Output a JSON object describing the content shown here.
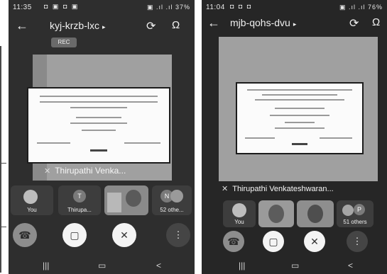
{
  "phone_a": {
    "status_time": "11:35",
    "status_notifications": "◘ ▣ ◘ ▣",
    "status_right": "▣ .ıl .ıl 37%",
    "meeting_code": "kyj-krzb-lxc",
    "rec_label": "REC",
    "presenter_name": "Thirupathi Venka...",
    "tiles": [
      {
        "label": "You"
      },
      {
        "label": "Thirupa..."
      },
      {
        "label": ""
      },
      {
        "label": "52 othe..."
      }
    ],
    "others_initial": "N",
    "thirupathi_initial": "T"
  },
  "phone_b": {
    "status_time": "11:04",
    "status_notifications": "◘ ◘ ◘",
    "status_right": "▣ .ıl .ıl 76%",
    "meeting_code": "mjb-qohs-dvu",
    "presenter_name": "Thirupathi Venkateshwaran...",
    "tiles": [
      {
        "label": "You"
      },
      {
        "label": ""
      },
      {
        "label": ""
      },
      {
        "label": "51 others"
      }
    ],
    "others_initial": "P"
  },
  "icons": {
    "back": "←",
    "caret": "▸",
    "switch_camera": "⟳",
    "audio": "Ω",
    "mic_off": "✕",
    "end_call": "☎",
    "camera_off": "▢",
    "more": "⋮",
    "nav_recents": "|||",
    "nav_home": "▭",
    "nav_back": "<"
  },
  "colors": {
    "background": "#2b2b2b",
    "stage": "#a0a0a0",
    "slide": "#fbfbfb"
  }
}
